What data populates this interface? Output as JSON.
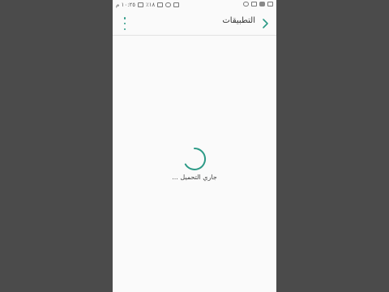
{
  "status_bar": {
    "time": "١٠:٢٥ م",
    "battery": "٪١٨",
    "icons_left": [
      "battery-icon",
      "signal-icon",
      "wifi-icon",
      "no-sim-icon"
    ],
    "icons_right": [
      "notification-icon",
      "gallery-icon",
      "youtube-icon",
      "video-icon"
    ]
  },
  "app_bar": {
    "title": "التطبيقات",
    "back_icon": "chevron-right-icon",
    "more_icon": "more-vert-icon",
    "accent_color": "#2c9a86"
  },
  "content": {
    "loading_text": "جاري التحميل ...",
    "spinner_color": "#2c9a86"
  }
}
